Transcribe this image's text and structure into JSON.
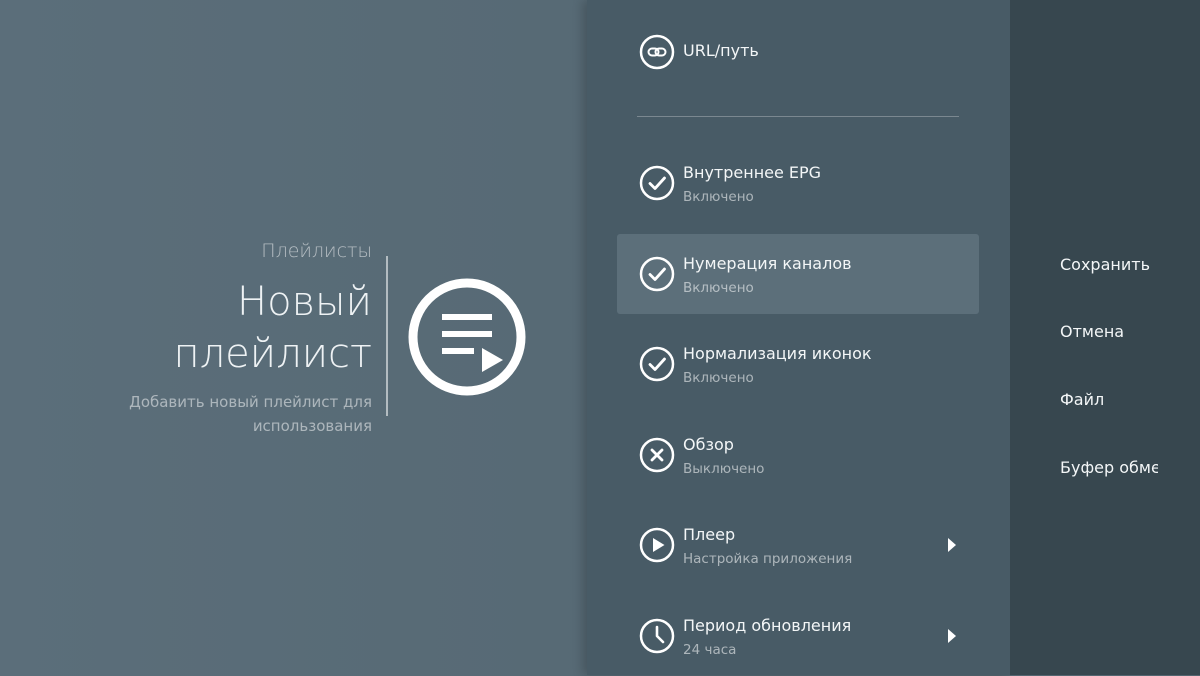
{
  "guidance": {
    "breadcrumb": "Плейлисты",
    "title_line1": "Новый",
    "title_line2": "плейлист",
    "description": "Добавить новый плейлист для использования",
    "icon": "playlist-play-icon"
  },
  "actions": [
    {
      "label": "URL/путь",
      "icon": "link-icon"
    },
    {
      "label": "Внутреннее EPG",
      "sublabel": "Включено",
      "icon": "check-circle-icon"
    },
    {
      "label": "Нумерация каналов",
      "sublabel": "Включено",
      "icon": "check-circle-icon"
    },
    {
      "label": "Нормализация иконок",
      "sublabel": "Включено",
      "icon": "check-circle-icon"
    },
    {
      "label": "Обзор",
      "sublabel": "Выключено",
      "icon": "x-circle-icon"
    },
    {
      "label": "Плеер",
      "sublabel": "Настройка приложения",
      "icon": "play-circle-icon"
    },
    {
      "label": "Период обновления",
      "sublabel": "24 часа",
      "icon": "clock-icon"
    }
  ],
  "buttons": [
    {
      "label": "Сохранить"
    },
    {
      "label": "Отмена"
    },
    {
      "label": "Файл"
    },
    {
      "label": "Буфер обмена"
    }
  ],
  "colors": {
    "guidance_bg": "#56697a",
    "actions_bg": "#485b66",
    "buttons_bg": "#37474f",
    "focus_bg": "#5c6f7a"
  }
}
